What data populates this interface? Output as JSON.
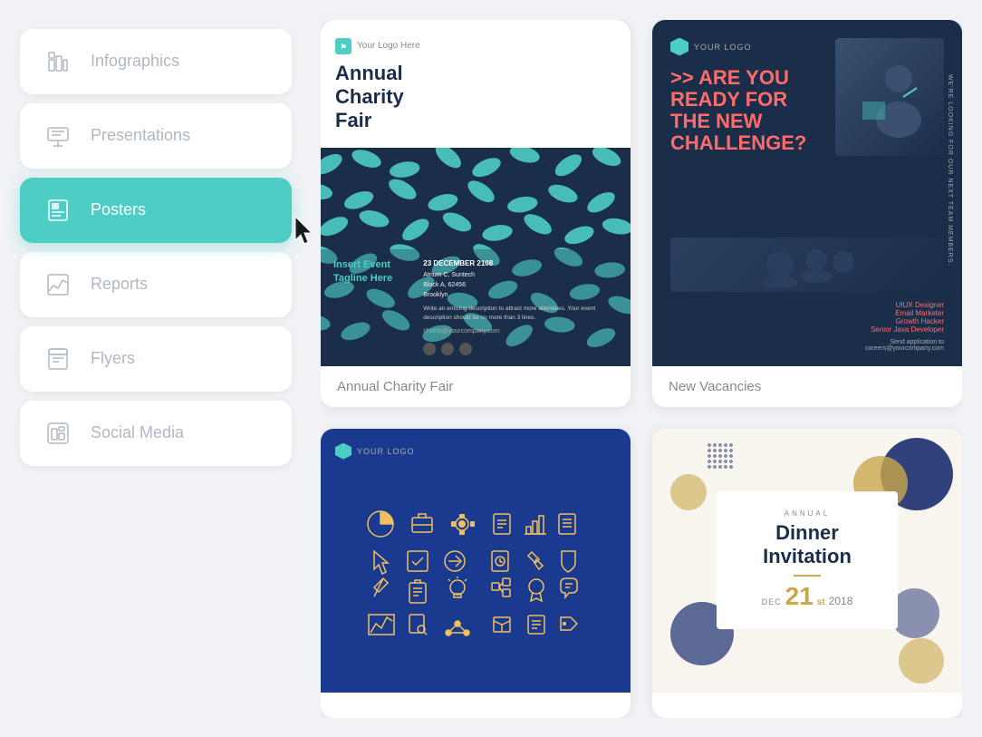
{
  "sidebar": {
    "items": [
      {
        "id": "infographics",
        "label": "Infographics",
        "icon": "bar-chart-icon",
        "active": false
      },
      {
        "id": "presentations",
        "label": "Presentations",
        "icon": "presentation-icon",
        "active": false
      },
      {
        "id": "posters",
        "label": "Posters",
        "icon": "poster-icon",
        "active": true
      },
      {
        "id": "reports",
        "label": "Reports",
        "icon": "reports-icon",
        "active": false
      },
      {
        "id": "flyers",
        "label": "Flyers",
        "icon": "flyers-icon",
        "active": false
      },
      {
        "id": "social-media",
        "label": "Social Media",
        "icon": "social-icon",
        "active": false
      }
    ]
  },
  "cards": [
    {
      "id": "annual-charity-fair",
      "label": "Annual Charity Fair",
      "logo_text": "Your Logo Here",
      "title_line1": "Annual",
      "title_line2": "Charity",
      "title_line3": "Fair",
      "tagline": "Insert Event Tagline Here",
      "date": "23 DECEMBER 2108",
      "venue": "Atrium C, Suntech",
      "address": "Block A, 62456",
      "city": "Brooklyn",
      "description": "Write an enticing description to attract more attendees. Your event description should be no more than 3 lines.",
      "email": "charity@yourcompany.com"
    },
    {
      "id": "new-vacancies",
      "label": "New Vacancies",
      "logo_text": "YOUR LOGO",
      "headline_line1": ">> ARE YOU",
      "headline_line2": "READY FOR",
      "headline_line3": "THE NEW",
      "headline_line4": "CHALLENGE?",
      "side_text": "WE'RE LOOKING FOR OUR NEXT TEAM MEMBERS.",
      "roles": [
        "UIUX Designer",
        "Email Marketer",
        "Growth Hacker",
        "Senior Java Developer"
      ],
      "cta": "Send application to",
      "email": "careers@yourcompany.com"
    },
    {
      "id": "business-icons",
      "label": "",
      "logo_text": "YOUR LOGO"
    },
    {
      "id": "dinner-invitation",
      "label": "",
      "annual_text": "ANNUAL",
      "title_line1": "Dinner",
      "title_line2": "Invitation",
      "month": "DEC",
      "day": "21",
      "day_suffix": "st",
      "year": "2018"
    }
  ],
  "colors": {
    "teal": "#4ecdc4",
    "navy": "#1a2e4a",
    "coral": "#ff6b6b",
    "gold": "#c9a84c",
    "sidebar_active_bg": "#4ecdc4",
    "sidebar_icon_inactive": "#b0b8c4",
    "bg": "#f0f2f5"
  }
}
